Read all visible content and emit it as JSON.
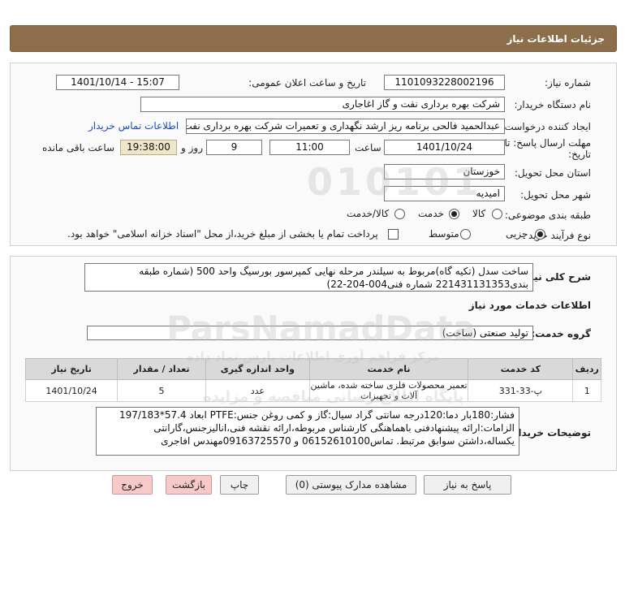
{
  "header": {
    "title": "جزئیات اطلاعات نیاز"
  },
  "form": {
    "need_number_label": "شماره نیاز:",
    "need_number": "1101093228002196",
    "announce_label": "تاریخ و ساعت اعلان عمومی:",
    "announce_value": "1401/10/14 - 15:07",
    "buyer_org_label": "نام دستگاه خریدار:",
    "buyer_org": "شرکت بهره برداری نفت و گاز اغاجاری",
    "creator_label": "ایجاد کننده درخواست:",
    "creator": "عبدالحمید فالحی برنامه ریز ارشد نگهداری و تعمیرات شرکت بهره برداری نفت و گ",
    "contact_link": "اطلاعات تماس خریدار",
    "deadline_label_1": "مهلت ارسال پاسخ: تا",
    "deadline_label_2": "تاریخ:",
    "deadline_date": "1401/10/24",
    "time_label": "ساعت",
    "deadline_time": "11:00",
    "days_value": "9",
    "days_label": "روز و",
    "remaining_time": "19:38:00",
    "remaining_label": "ساعت باقی مانده",
    "province_label": "استان محل تحویل:",
    "province": "خوزستان",
    "city_label": "شهر محل تحویل:",
    "city": "امیدیه",
    "category_label": "طبقه بندی موضوعی:",
    "category_options": [
      "کالا",
      "خدمت",
      "کالا/خدمت"
    ],
    "category_selected": "خدمت",
    "process_label": "نوع فرآیند خرید :",
    "process_options": [
      "جزیی",
      "متوسط"
    ],
    "process_selected": "جزیی",
    "payment_text": "پرداخت تمام یا بخشی از مبلغ خرید،از محل \"اسناد خزانه اسلامی\" خواهد بود."
  },
  "summary": {
    "label": "شرح کلی نیاز:",
    "line1": "ساخت سدل (تکیه گاه)مربوط به سیلندر مرحله نهایی کمپرسور بورسیگ واحد 500 (شماره طبقه",
    "line2": "بندی221431131353 شماره فنی004-204-22)"
  },
  "services": {
    "section_title": "اطلاعات خدمات مورد نیاز",
    "group_label": "گروه خدمت:",
    "group_value": "تولید صنعتی (ساخت)",
    "columns": [
      "ردیف",
      "کد خدمت",
      "نام خدمت",
      "واحد اندازه گیری",
      "تعداد / مقدار",
      "تاریخ نیاز"
    ],
    "rows": [
      [
        "1",
        "پ-33-331",
        "تعمیر محصولات فلزی ساخته شده، ماشین آلات و تجهیزات",
        "عدد",
        "5",
        "1401/10/24"
      ]
    ]
  },
  "buyer_notes": {
    "label": "توضیحات خریدار:",
    "line1": "فشار:180بار دما:120درجه سانتی گراد  سیال:گاز و کمی روغن  جنس:PTFE   ابعاد 57.4*197/183",
    "line2": "الزامات:ارائه پیشنهادفنی باهماهنگی کارشناس مربوطه،ارائه نقشه فنی،انالیزجنس،گارانتی",
    "line3": "یکساله،داشتن سوابق مرتبط. تماس06152610100 و 09163725570مهندس افاجری"
  },
  "buttons": {
    "reply": "پاسخ به نیاز",
    "attachments": "مشاهده مدارک پیوستی (0)",
    "print": "چاپ",
    "back": "بازگشت",
    "exit": "خروج"
  },
  "watermark": {
    "digits": "010101",
    "brand": "ParsNamadData",
    "line1": "مرکز فراهم آوری اطلاعات پارس نماد داده",
    "line2": "پایگاه اطلاع رسانی مناقصه و مزایده"
  }
}
